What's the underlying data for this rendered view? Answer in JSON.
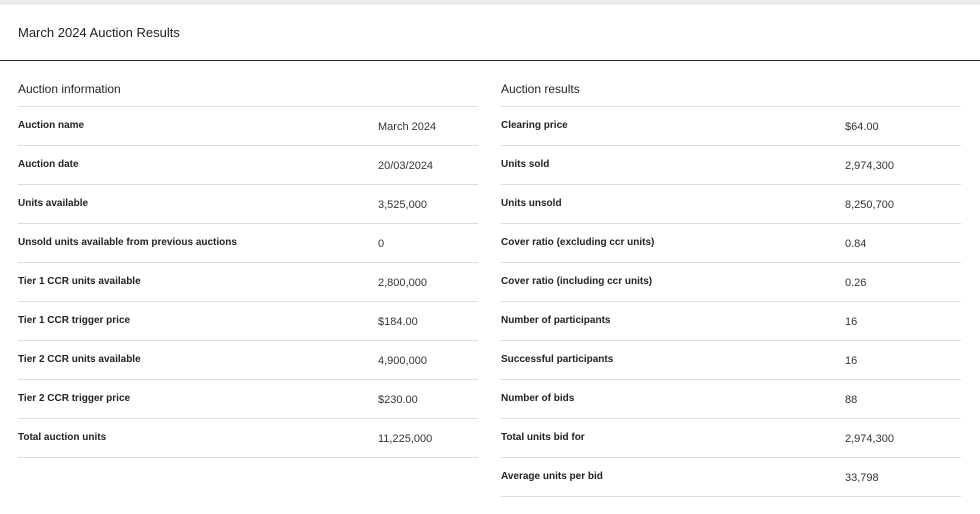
{
  "page_title": "March 2024 Auction Results",
  "auction_information": {
    "heading": "Auction information",
    "rows": [
      {
        "label": "Auction name",
        "value": "March 2024"
      },
      {
        "label": "Auction date",
        "value": "20/03/2024"
      },
      {
        "label": "Units available",
        "value": "3,525,000"
      },
      {
        "label": "Unsold units available from previous auctions",
        "value": "0"
      },
      {
        "label": "Tier 1 CCR units available",
        "value": "2,800,000"
      },
      {
        "label": "Tier 1 CCR trigger price",
        "value": "$184.00"
      },
      {
        "label": "Tier 2 CCR units available",
        "value": "4,900,000"
      },
      {
        "label": "Tier 2 CCR trigger price",
        "value": "$230.00"
      },
      {
        "label": "Total auction units",
        "value": "11,225,000"
      }
    ]
  },
  "auction_results": {
    "heading": "Auction results",
    "rows": [
      {
        "label": "Clearing price",
        "value": "$64.00"
      },
      {
        "label": "Units sold",
        "value": "2,974,300"
      },
      {
        "label": "Units unsold",
        "value": "8,250,700"
      },
      {
        "label": "Cover ratio (excluding ccr units)",
        "value": "0.84"
      },
      {
        "label": "Cover ratio (including ccr units)",
        "value": "0.26"
      },
      {
        "label": "Number of participants",
        "value": "16"
      },
      {
        "label": "Successful participants",
        "value": "16"
      },
      {
        "label": "Number of bids",
        "value": "88"
      },
      {
        "label": "Total units bid for",
        "value": "2,974,300"
      },
      {
        "label": "Average units per bid",
        "value": "33,798"
      }
    ]
  }
}
